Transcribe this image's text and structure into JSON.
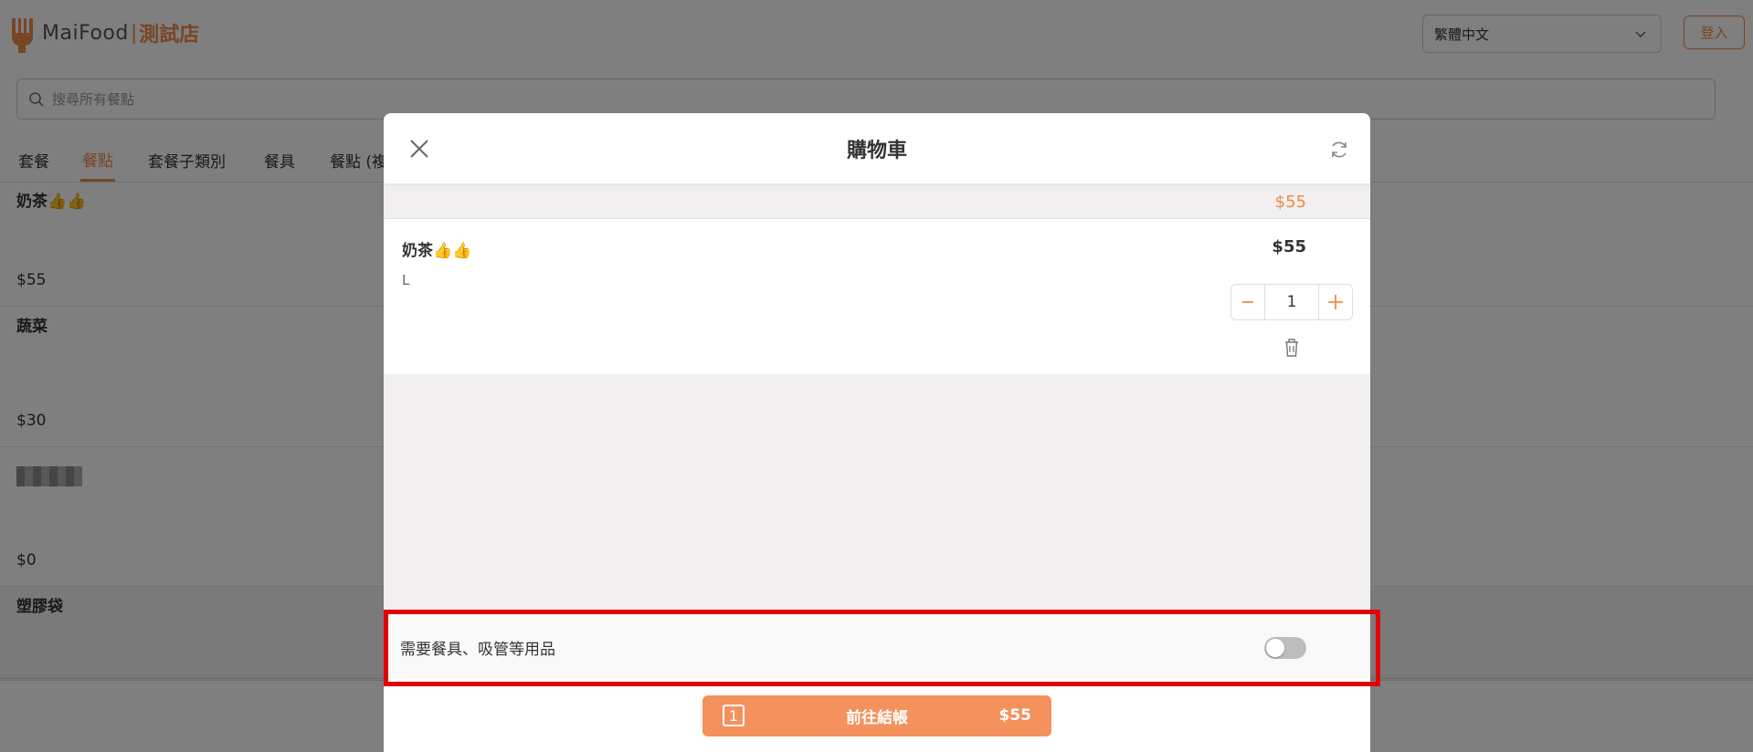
{
  "header": {
    "brand": "MaiFood",
    "separator": "|",
    "store_name": "測試店",
    "language": "繁體中文",
    "login_label": "登入"
  },
  "search": {
    "placeholder": "搜尋所有餐點"
  },
  "tabs": [
    {
      "label": "套餐",
      "active": false
    },
    {
      "label": "餐點",
      "active": true
    },
    {
      "label": "套餐子類別",
      "active": false
    },
    {
      "label": "餐具",
      "active": false
    },
    {
      "label": "餐點 (複",
      "active": false
    }
  ],
  "menu_items": [
    {
      "name": "奶茶👍👍",
      "price": "$55"
    },
    {
      "name": "蔬菜",
      "price": "$30"
    },
    {
      "name": "",
      "price": "$0"
    },
    {
      "name": "塑膠袋",
      "price": ""
    }
  ],
  "cart": {
    "title": "購物車",
    "subtotal": "$55",
    "items": [
      {
        "name": "奶茶👍👍",
        "option": "L",
        "price": "$55",
        "quantity": "1"
      }
    ],
    "utensils_label": "需要餐具、吸管等用品",
    "utensils_enabled": false,
    "checkout": {
      "count": "1",
      "label": "前往結帳",
      "amount": "$55"
    }
  },
  "colors": {
    "accent": "#f08a4b",
    "checkout": "#f4915c",
    "highlight": "#e30000"
  },
  "icons": [
    "logo-icon",
    "chevron-down-icon",
    "search-icon",
    "close-icon",
    "refresh-icon",
    "minus-icon",
    "plus-icon",
    "trash-icon"
  ]
}
